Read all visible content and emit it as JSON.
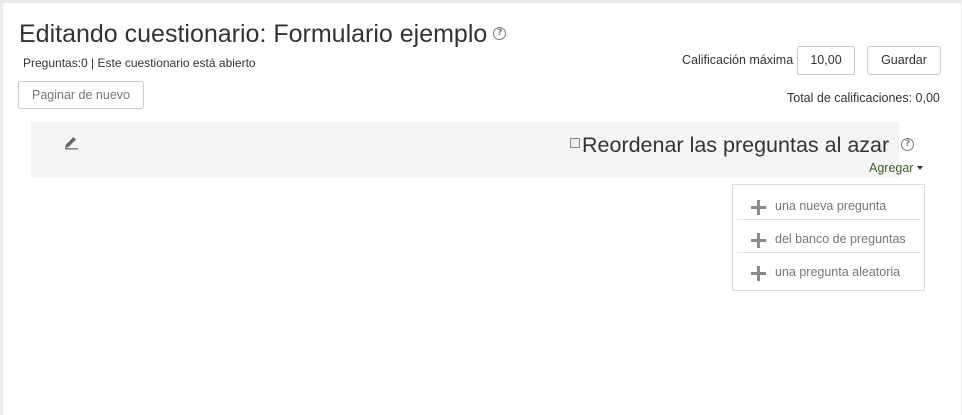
{
  "header": {
    "title": "Editando cuestionario: Formulario ejemplo",
    "status": "Preguntas:0 | Este cuestionario está abierto"
  },
  "toolbar": {
    "repaginate_label": "Paginar de nuevo",
    "max_grade_label": "Calificación máxima",
    "max_grade_value": "10,00",
    "save_label": "Guardar",
    "total_grades": "Total de calificaciones: 0,00"
  },
  "section": {
    "shuffle_label": "Reordenar las preguntas al azar",
    "add_label": "Agregar"
  },
  "add_menu": {
    "items": [
      {
        "label": "una nueva pregunta",
        "icon": "plus-icon"
      },
      {
        "label": "del banco de preguntas",
        "icon": "plus-icon"
      },
      {
        "label": "una pregunta aleatoria",
        "icon": "plus-icon"
      }
    ]
  },
  "icons": {
    "help": "help-icon",
    "edit": "pencil-icon",
    "dropdown": "caret-down-icon"
  },
  "colors": {
    "link": "#3d5c26",
    "section_bg": "#f5f5f5"
  }
}
